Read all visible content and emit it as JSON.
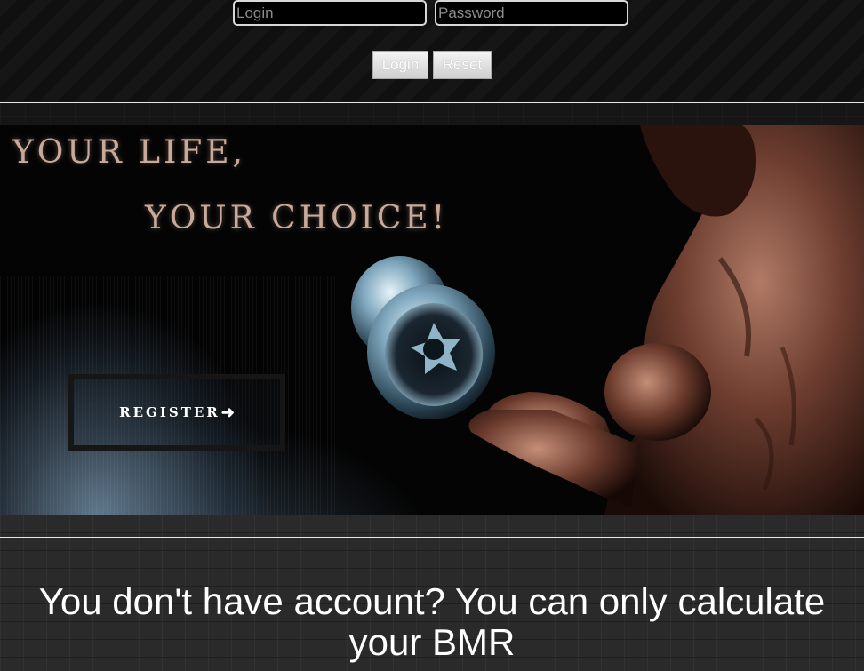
{
  "login_bar": {
    "login_placeholder": "Login",
    "password_placeholder": "Password",
    "login_button": "Login",
    "reset_button": "Reset"
  },
  "hero": {
    "title_line_1": "YOUR LIFE,",
    "title_line_2": "YOUR CHOICE!",
    "register_button": "REGISTER",
    "register_icon": "arrow-right-icon"
  },
  "message": {
    "text": "You don't have account? You can only calculate your BMR"
  },
  "colors": {
    "title_text": "#c9aa9a",
    "button_face": "#e0e0e0",
    "page_background": "#161616"
  }
}
